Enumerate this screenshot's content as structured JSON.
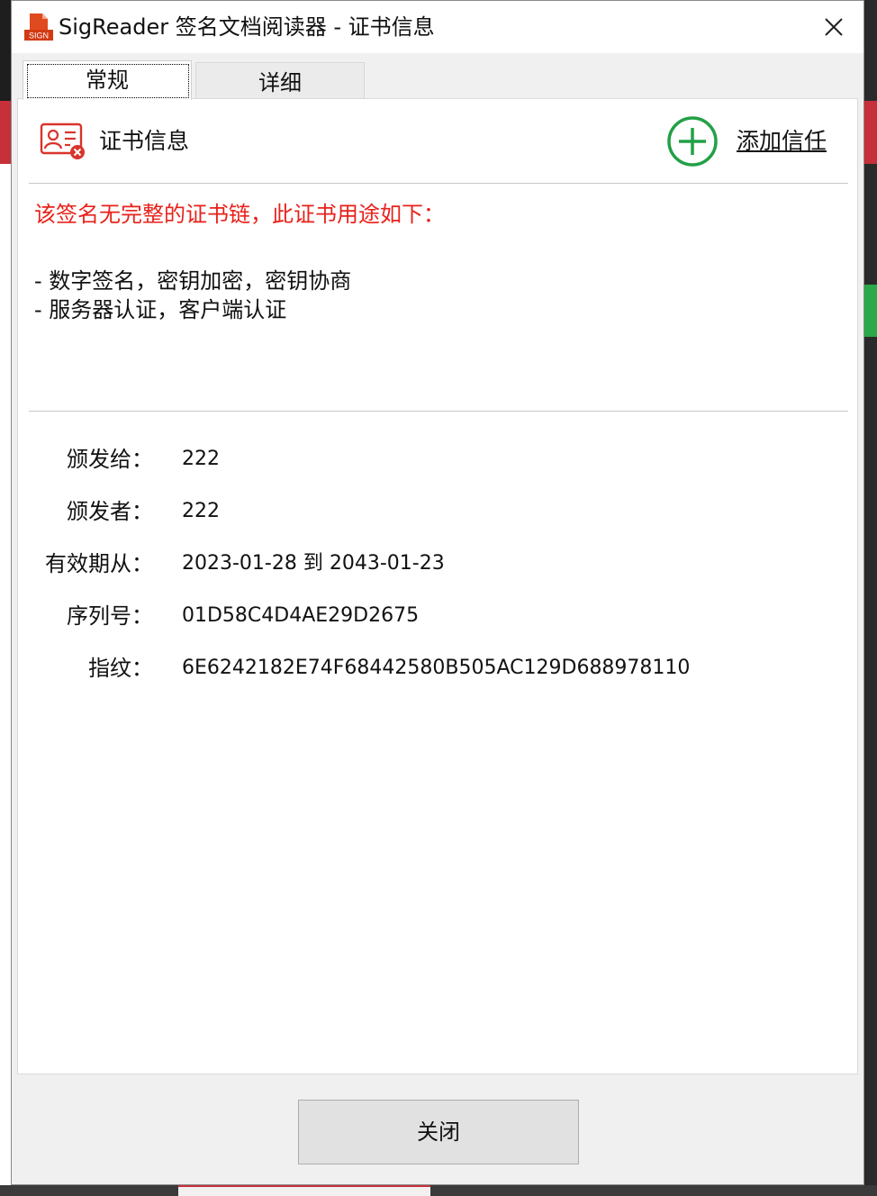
{
  "window": {
    "title": "SigReader 签名文档阅读器 - 证书信息",
    "icon_label": "SIGN"
  },
  "tabs": [
    {
      "label": "常规",
      "selected": true
    },
    {
      "label": "详细",
      "selected": false
    }
  ],
  "header": {
    "title": "证书信息",
    "add_trust_label": "添加信任"
  },
  "warning": "该签名无完整的证书链，此证书用途如下：",
  "usages": [
    "- 数字签名，密钥加密，密钥协商",
    "- 服务器认证，客户端认证"
  ],
  "fields": [
    {
      "label": "颁发给：",
      "value": "222"
    },
    {
      "label": "颁发者：",
      "value": "222"
    },
    {
      "label": "有效期从：",
      "value": "2023-01-28 到 2043-01-23"
    },
    {
      "label": "序列号：",
      "value": "01D58C4D4AE29D2675"
    },
    {
      "label": "指纹：",
      "value": "6E6242182E74F68442580B505AC129D688978110"
    }
  ],
  "buttons": {
    "close": "关闭"
  },
  "colors": {
    "warning": "#e8221b",
    "add_trust_green": "#22a046",
    "cert_icon_red": "#d9342b"
  }
}
